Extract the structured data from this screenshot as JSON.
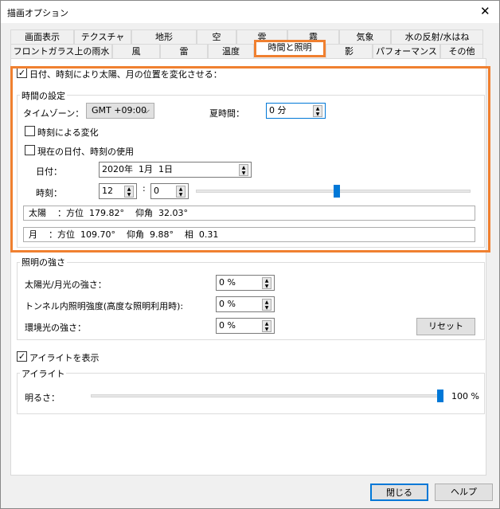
{
  "window": {
    "title": "描画オプション",
    "close": "✕"
  },
  "tabs_row1": [
    "画面表示",
    "テクスチャ",
    "地形",
    "空",
    "雲",
    "霧",
    "気象",
    "水の反射/水はね"
  ],
  "tabs_row2": [
    "フロントガラス上の雨水",
    "風",
    "雷",
    "温度",
    "時間と照明",
    "影",
    "パフォーマンス",
    "その他"
  ],
  "active_tab": "時間と照明",
  "sun_moon": {
    "label": "日付、時刻により太陽、月の位置を変化させる：",
    "checked": true
  },
  "time_settings": {
    "group_label": "時間の設定",
    "timezone_label": "タイムゾーン：",
    "timezone_value": "GMT +09:00",
    "dst_label": "夏時間：",
    "dst_value": "0 分",
    "time_change_label": "時刻による変化",
    "time_change_checked": false,
    "use_current_label": "現在の日付、時刻の使用",
    "use_current_checked": false,
    "date_label": "日付：",
    "date_value": "2020年  1月  1日",
    "time_label": "時刻：",
    "hour": "12",
    "colon": ":",
    "minute": "0",
    "time_slider_fraction": 0.5,
    "sun_info": "太陽    ：方位  179.82°    仰角  32.03°",
    "moon_info": "月    ：方位  109.70°    仰角  9.88°    相  0.31"
  },
  "lighting": {
    "group_label": "照明の強さ",
    "rows": [
      {
        "label": "太陽光/月光の強さ：",
        "value": "0 %"
      },
      {
        "label": "トンネル内照明強度(高度な照明利用時):",
        "value": "0 %"
      },
      {
        "label": "環境光の強さ：",
        "value": "0 %"
      }
    ],
    "reset": "リセット"
  },
  "eyelight": {
    "checkbox_label": "アイライトを表示",
    "checked": true,
    "group_label": "アイライト",
    "brightness_label": "明るさ：",
    "brightness_value": "100 %",
    "brightness_fraction": 1.0
  },
  "footer": {
    "close": "閉じる",
    "help": "ヘルプ"
  }
}
